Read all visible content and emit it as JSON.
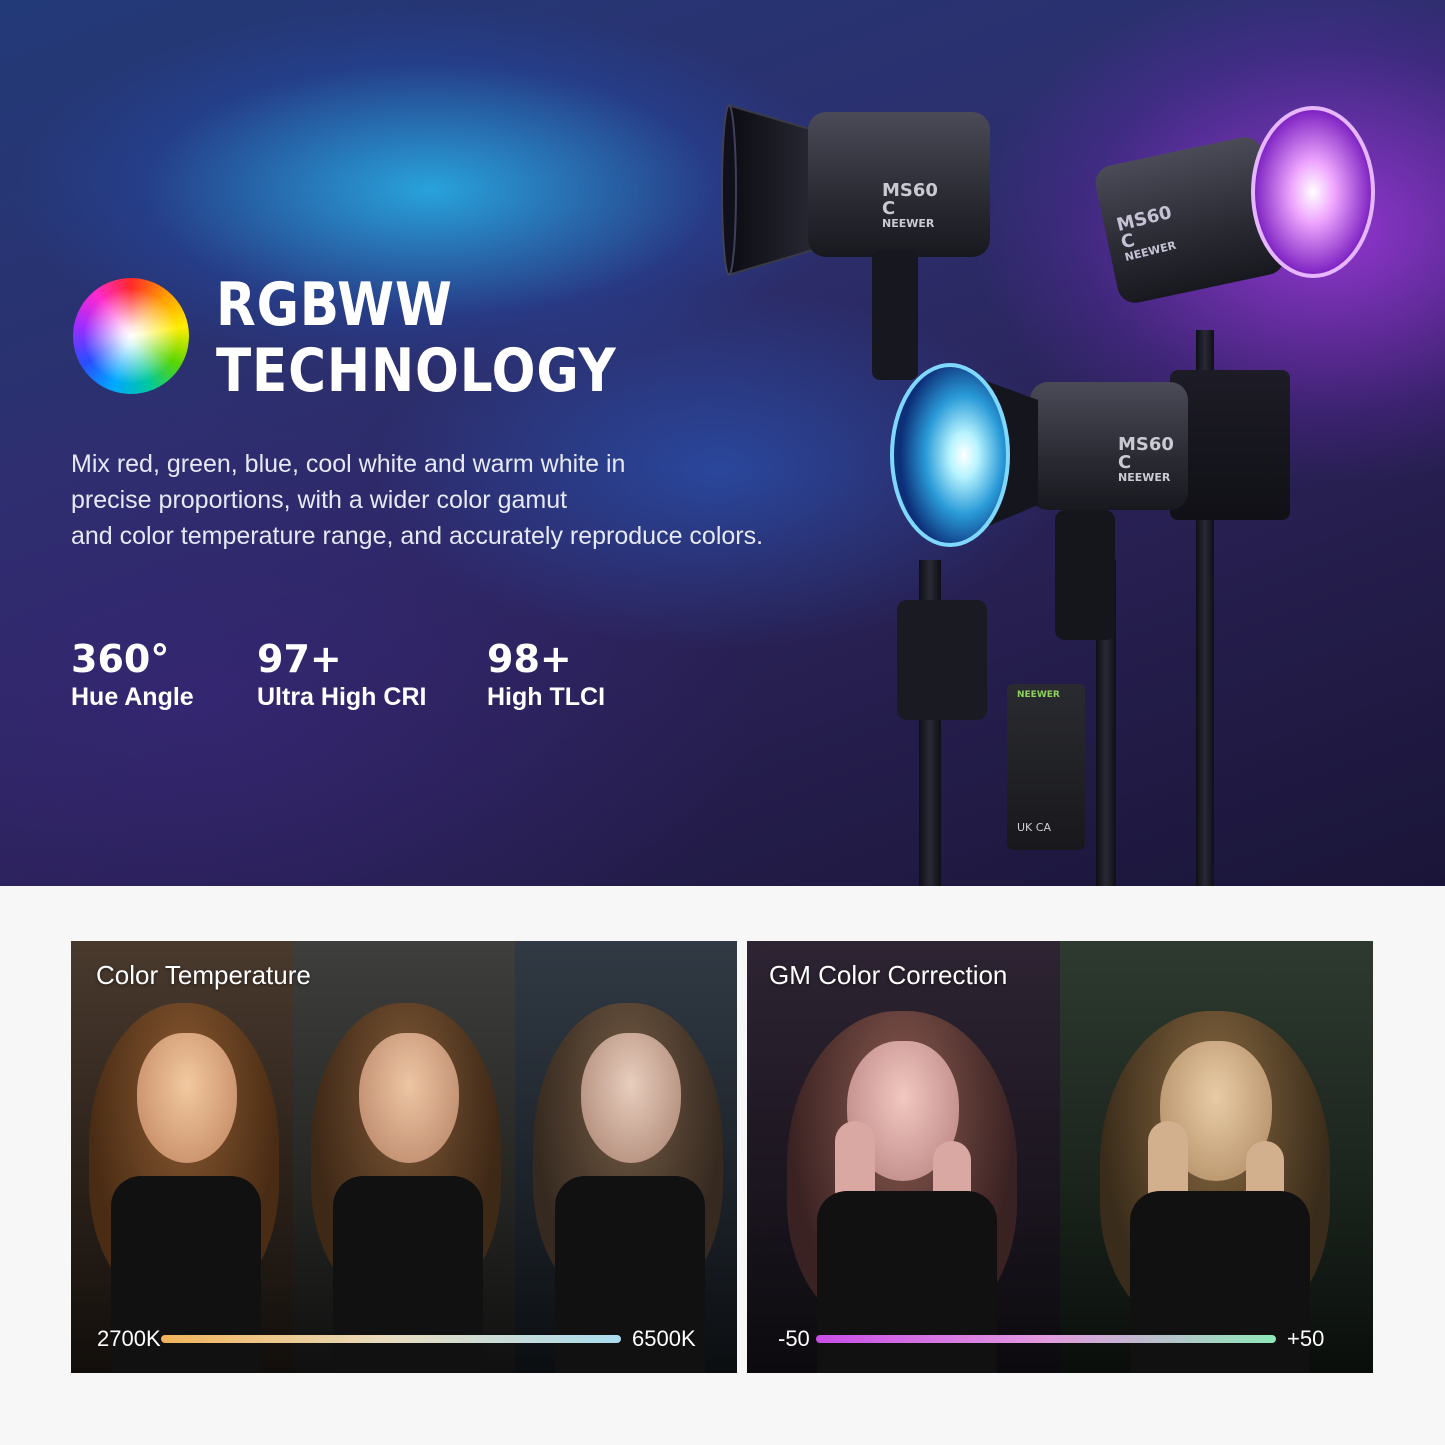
{
  "hero": {
    "headline_line1": "RGBWW",
    "headline_line2": "TECHNOLOGY",
    "description": [
      "Mix red, green, blue, cool white and warm white in",
      "precise proportions, with a wider color gamut",
      "and color temperature range, and accurately reproduce colors."
    ],
    "stats": [
      {
        "value": "360°",
        "label": "Hue Angle"
      },
      {
        "value": "97+",
        "label": "Ultra High CRI"
      },
      {
        "value": "98+",
        "label": "High TLCI"
      }
    ],
    "product_model": "MS60",
    "product_badge": "C",
    "brand": "NEEWER",
    "battery_brand": "NEEWER",
    "battery_marks": "UK CA"
  },
  "color_temperature": {
    "title": "Color Temperature",
    "min_label": "2700K",
    "max_label": "6500K",
    "gradient": [
      "#f2b35a",
      "#e8dcc0",
      "#a9dcf0"
    ]
  },
  "gm_correction": {
    "title": "GM Color Correction",
    "min_label": "-50",
    "max_label": "+50",
    "gradient": [
      "#c94ee8",
      "#e39adf",
      "#8ee8b8"
    ]
  }
}
